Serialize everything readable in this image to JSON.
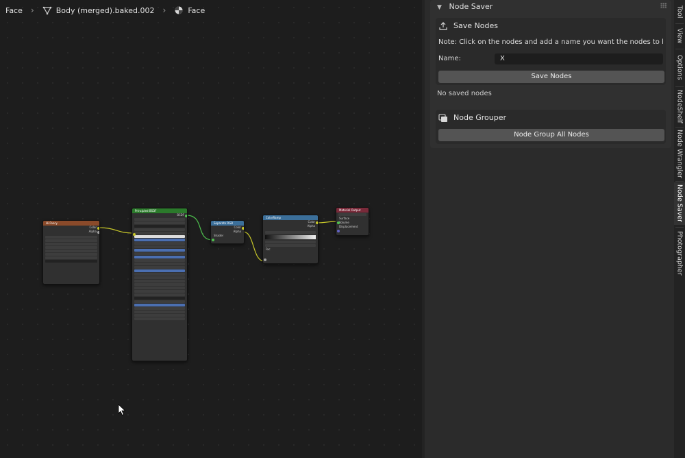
{
  "breadcrumb": {
    "items": [
      {
        "label": "Face",
        "icon": null
      },
      {
        "label": "Body (merged).baked.002",
        "icon": "mesh-triangle-icon"
      },
      {
        "label": "Face",
        "icon": "material-sphere-icon"
      }
    ]
  },
  "nodes": {
    "image_texture": {
      "title": "Hi Fancy",
      "header_color": "#8a4a2a"
    },
    "principled_bsdf": {
      "title": "Principled BSDF",
      "header_color": "#2b7a2b"
    },
    "separate_rgb": {
      "title": "Separate RGB",
      "header_color": "#3b6f9a"
    },
    "color_ramp": {
      "title": "ColorRamp",
      "header_color": "#3b6f9a"
    },
    "material_output": {
      "title": "Material Output",
      "header_color": "#7a2a3a"
    }
  },
  "sidebar": {
    "panel_title": "Node Saver",
    "save_nodes": {
      "title": "Save Nodes",
      "note": "Note: Click on the nodes and add a name you want the nodes to be saved ...",
      "name_label": "Name:",
      "name_value": "X",
      "button_label": "Save Nodes"
    },
    "no_saved_text": "No saved nodes",
    "node_grouper": {
      "title": "Node Grouper",
      "button_label": "Node Group All Nodes"
    }
  },
  "tabs": [
    {
      "label": "Tool"
    },
    {
      "label": "View"
    },
    {
      "label": "Options"
    },
    {
      "label": "NodeShelf"
    },
    {
      "label": "Node Wrangler"
    },
    {
      "label": "Node Saver",
      "active": true
    },
    {
      "label": "Photographer"
    }
  ]
}
